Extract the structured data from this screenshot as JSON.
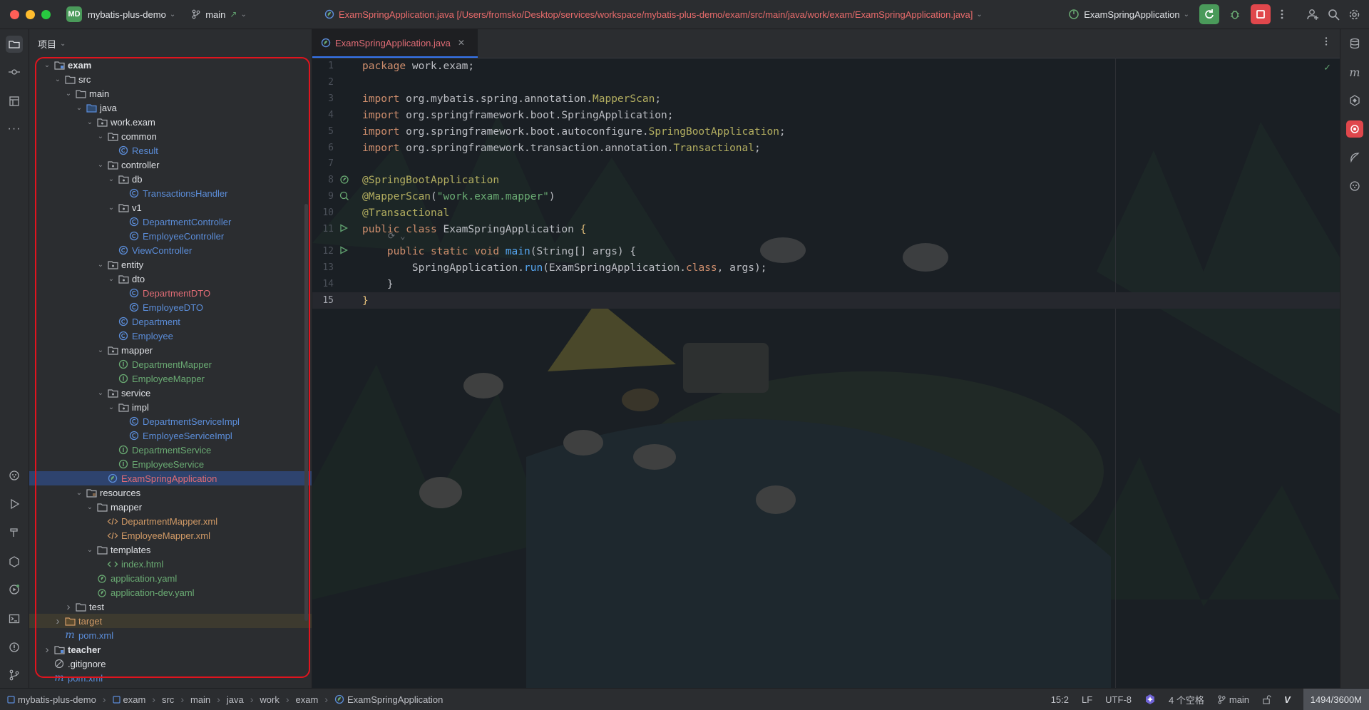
{
  "titlebar": {
    "project_badge": "MD",
    "project_name": "mybatis-plus-demo",
    "branch": "main",
    "file_path": "ExamSpringApplication.java [/Users/fromsko/Desktop/services/workspace/mybatis-plus-demo/exam/src/main/java/work/exam/ExamSpringApplication.java]",
    "run_config": "ExamSpringApplication"
  },
  "project_panel": {
    "title": "项目",
    "tree": [
      {
        "label": "exam",
        "depth": 1,
        "expanded": true,
        "icon": "module-folder-icon",
        "bold": true
      },
      {
        "label": "src",
        "depth": 2,
        "expanded": true,
        "icon": "folder-icon"
      },
      {
        "label": "main",
        "depth": 3,
        "expanded": true,
        "icon": "folder-icon"
      },
      {
        "label": "java",
        "depth": 4,
        "expanded": true,
        "icon": "source-folder-icon"
      },
      {
        "label": "work.exam",
        "depth": 5,
        "expanded": true,
        "icon": "package-icon"
      },
      {
        "label": "common",
        "depth": 6,
        "expanded": true,
        "icon": "package-icon"
      },
      {
        "label": "Result",
        "depth": 7,
        "icon": "class-icon",
        "color": "#5b8dd9"
      },
      {
        "label": "controller",
        "depth": 6,
        "expanded": true,
        "icon": "package-icon"
      },
      {
        "label": "db",
        "depth": 7,
        "expanded": true,
        "icon": "package-icon"
      },
      {
        "label": "TransactionsHandler",
        "depth": 8,
        "icon": "class-icon",
        "color": "#5b8dd9"
      },
      {
        "label": "v1",
        "depth": 7,
        "expanded": true,
        "icon": "package-icon"
      },
      {
        "label": "DepartmentController",
        "depth": 8,
        "icon": "class-icon",
        "color": "#5b8dd9"
      },
      {
        "label": "EmployeeController",
        "depth": 8,
        "icon": "class-icon",
        "color": "#5b8dd9"
      },
      {
        "label": "ViewController",
        "depth": 7,
        "icon": "class-icon",
        "color": "#5b8dd9"
      },
      {
        "label": "entity",
        "depth": 6,
        "expanded": true,
        "icon": "package-icon"
      },
      {
        "label": "dto",
        "depth": 7,
        "expanded": true,
        "icon": "package-icon"
      },
      {
        "label": "DepartmentDTO",
        "depth": 8,
        "icon": "class-icon",
        "color": "#e06c75"
      },
      {
        "label": "EmployeeDTO",
        "depth": 8,
        "icon": "class-icon",
        "color": "#5b8dd9"
      },
      {
        "label": "Department",
        "depth": 7,
        "icon": "class-icon",
        "color": "#5b8dd9"
      },
      {
        "label": "Employee",
        "depth": 7,
        "icon": "class-icon",
        "color": "#5b8dd9"
      },
      {
        "label": "mapper",
        "depth": 6,
        "expanded": true,
        "icon": "package-icon"
      },
      {
        "label": "DepartmentMapper",
        "depth": 7,
        "icon": "interface-icon",
        "color": "#6aab73"
      },
      {
        "label": "EmployeeMapper",
        "depth": 7,
        "icon": "interface-icon",
        "color": "#6aab73"
      },
      {
        "label": "service",
        "depth": 6,
        "expanded": true,
        "icon": "package-icon"
      },
      {
        "label": "impl",
        "depth": 7,
        "expanded": true,
        "icon": "package-icon"
      },
      {
        "label": "DepartmentServiceImpl",
        "depth": 8,
        "icon": "class-icon",
        "color": "#5b8dd9"
      },
      {
        "label": "EmployeeServiceImpl",
        "depth": 8,
        "icon": "class-icon",
        "color": "#5b8dd9"
      },
      {
        "label": "DepartmentService",
        "depth": 7,
        "icon": "interface-icon",
        "color": "#6aab73"
      },
      {
        "label": "EmployeeService",
        "depth": 7,
        "icon": "interface-icon",
        "color": "#6aab73"
      },
      {
        "label": "ExamSpringApplication",
        "depth": 6,
        "icon": "spring-class-icon",
        "color": "#e06c75",
        "selected": true
      },
      {
        "label": "resources",
        "depth": 4,
        "expanded": true,
        "icon": "resources-folder-icon"
      },
      {
        "label": "mapper",
        "depth": 5,
        "expanded": true,
        "icon": "folder-icon"
      },
      {
        "label": "DepartmentMapper.xml",
        "depth": 6,
        "icon": "xml-file-icon",
        "color": "#d19a66"
      },
      {
        "label": "EmployeeMapper.xml",
        "depth": 6,
        "icon": "xml-file-icon",
        "color": "#d19a66"
      },
      {
        "label": "templates",
        "depth": 5,
        "expanded": true,
        "icon": "folder-icon"
      },
      {
        "label": "index.html",
        "depth": 6,
        "icon": "html-file-icon",
        "color": "#6aab73"
      },
      {
        "label": "application.yaml",
        "depth": 5,
        "icon": "yaml-file-icon",
        "color": "#6aab73"
      },
      {
        "label": "application-dev.yaml",
        "depth": 5,
        "icon": "yaml-file-icon",
        "color": "#6aab73"
      },
      {
        "label": "test",
        "depth": 3,
        "expanded": false,
        "icon": "folder-icon"
      },
      {
        "label": "target",
        "depth": 2,
        "expanded": false,
        "icon": "excluded-folder-icon",
        "color": "#d19a66",
        "target": true
      },
      {
        "label": "pom.xml",
        "depth": 2,
        "icon": "maven-file-icon",
        "color": "#5b8dd9"
      },
      {
        "label": "teacher",
        "depth": 1,
        "expanded": false,
        "icon": "module-folder-icon",
        "bold": true
      },
      {
        "label": ".gitignore",
        "depth": 1,
        "icon": "gitignore-icon"
      },
      {
        "label": "pom.xml",
        "depth": 1,
        "icon": "maven-file-icon",
        "color": "#5b8dd9"
      }
    ]
  },
  "editor": {
    "tab_label": "ExamSpringApplication.java",
    "current_line": 15,
    "inlay_hint": "⟳ ⌄",
    "lines": [
      {
        "n": 1,
        "html": "<span class=\"kw\">package</span> work.exam;"
      },
      {
        "n": 2,
        "html": ""
      },
      {
        "n": 3,
        "html": "<span class=\"kw\">import</span> org.mybatis.spring.annotation.<span class=\"ann\">MapperScan</span>;"
      },
      {
        "n": 4,
        "html": "<span class=\"kw\">import</span> org.springframework.boot.SpringApplication;"
      },
      {
        "n": 5,
        "html": "<span class=\"kw\">import</span> org.springframework.boot.autoconfigure.<span class=\"ann\">SpringBootApplication</span>;"
      },
      {
        "n": 6,
        "html": "<span class=\"kw\">import</span> org.springframework.transaction.annotation.<span class=\"ann\">Transactional</span>;"
      },
      {
        "n": 7,
        "html": ""
      },
      {
        "n": 8,
        "html": "<span class=\"ann\">@SpringBootApplication</span>",
        "gutter": "spring-bean-icon"
      },
      {
        "n": 9,
        "html": "<span class=\"ann\">@MapperScan</span>(<span class=\"str\">\"work.exam.mapper\"</span>)",
        "gutter": "spring-scan-icon"
      },
      {
        "n": 10,
        "html": "<span class=\"ann\">@Transactional</span>"
      },
      {
        "n": 11,
        "html": "<span class=\"kw\">public class</span> ExamSpringApplication <span class=\"br\">{</span>",
        "gutter": "run-icon"
      },
      {
        "n": 12,
        "html": "    <span class=\"kw\">public static void</span> <span class=\"fn\">main</span>(String[] args) {",
        "gutter": "run-icon"
      },
      {
        "n": 13,
        "html": "        SpringApplication.<span class=\"fn\">run</span>(ExamSpringApplication.<span class=\"kw\">class</span>, args);"
      },
      {
        "n": 14,
        "html": "    }"
      },
      {
        "n": 15,
        "html": "<span class=\"br\">}</span>"
      }
    ]
  },
  "statusbar": {
    "breadcrumbs": [
      "mybatis-plus-demo",
      "exam",
      "src",
      "main",
      "java",
      "work",
      "exam",
      "ExamSpringApplication"
    ],
    "position": "15:2",
    "line_sep": "LF",
    "encoding": "UTF-8",
    "indent": "4 个空格",
    "branch": "main",
    "memory": "1494/3600M"
  },
  "colors": {
    "accent": "#3574f0",
    "run_green": "#4a9a5a",
    "stop_red": "#e0474c",
    "error_red": "#e06c75",
    "highlight_box": "#e0141e"
  }
}
